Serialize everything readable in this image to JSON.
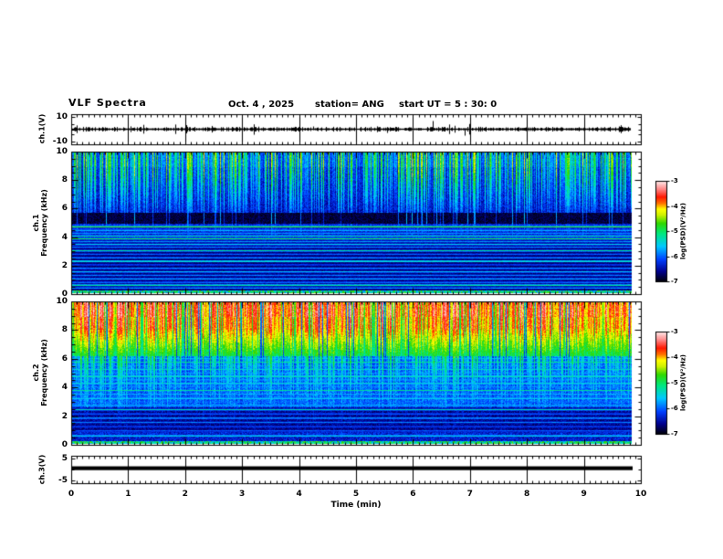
{
  "header": {
    "title": "VLF Spectra",
    "date": "Oct. 4 , 2025",
    "station": "station= ANG",
    "start_ut": "start UT =  5 : 30: 0"
  },
  "x_axis": {
    "label": "Time (min)",
    "tick_labels": [
      "0",
      "1",
      "2",
      "3",
      "4",
      "5",
      "6",
      "7",
      "8",
      "9",
      "10"
    ],
    "tick_values": [
      0,
      1,
      2,
      3,
      4,
      5,
      6,
      7,
      8,
      9,
      10
    ],
    "minor_step_min": 0.1,
    "range": [
      0,
      10
    ],
    "data_end_min": 9.82
  },
  "colorbar": {
    "label": "log(PSD)(V²/Hz)",
    "tick_labels": [
      "-3",
      "-4",
      "-5",
      "-6",
      "-7"
    ],
    "tick_values": [
      -3,
      -4,
      -5,
      -6,
      -7
    ],
    "value_range": [
      -7,
      -3
    ]
  },
  "colormap_stops": [
    [
      0.0,
      "#000008"
    ],
    [
      0.1,
      "#00008c"
    ],
    [
      0.22,
      "#0040ff"
    ],
    [
      0.35,
      "#00c8ff"
    ],
    [
      0.48,
      "#00e87a"
    ],
    [
      0.58,
      "#30d800"
    ],
    [
      0.66,
      "#ccf000"
    ],
    [
      0.72,
      "#ffff00"
    ],
    [
      0.78,
      "#ff7000"
    ],
    [
      0.84,
      "#ff1800"
    ],
    [
      0.92,
      "#ff8888"
    ],
    [
      1.0,
      "#ffecec"
    ]
  ],
  "chart_data": [
    {
      "id": "ch1-waveform",
      "type": "line",
      "ylabel": "ch.1(V)",
      "ylim": [
        -12.5,
        12.5
      ],
      "ytick_values": [
        10,
        -10
      ],
      "ytick_labels": [
        "10",
        "-10"
      ],
      "baseline_v": 0,
      "noise_v": 1.5,
      "seed": 5,
      "spikes": [
        {
          "t": 3.2,
          "v": -4.5
        },
        {
          "t": 4.25,
          "v": 3.0
        },
        {
          "t": 5.55,
          "v": -2.5
        },
        {
          "t": 6.35,
          "v": 7.5
        },
        {
          "t": 6.9,
          "v": -5.0
        }
      ]
    },
    {
      "id": "ch1-spectrogram",
      "type": "heatmap",
      "ylabel_lines": [
        "ch.1",
        "Frequency (kHz)"
      ],
      "ylim": [
        0,
        10
      ],
      "ytick_values": [
        0,
        2,
        4,
        6,
        8,
        10
      ],
      "ytick_labels": [
        "0",
        "2",
        "4",
        "6",
        "8",
        "10"
      ],
      "minor_step_kHz": 0.5,
      "seed": 42,
      "base_level": -6.95,
      "base_noise": 0.45,
      "streaks": {
        "density": 0.45,
        "min_freq": 5.6,
        "span": 4.2,
        "floor": 0.3,
        "gain": 2.1,
        "base": -6.75,
        "gap_dark": 0,
        "top_boost": 0.15,
        "leak_gain": 0.6,
        "leak_depth": 1.6,
        "leak_min_freq": 0.3
      },
      "dark_bands": [
        {
          "f0": 4.95,
          "f1": 5.75,
          "level": -7.0,
          "noise": 0.35,
          "leak": 1.2
        }
      ],
      "level_bands": [
        {
          "f0": 3.9,
          "f1": 4.95,
          "boost": 0.4
        },
        {
          "f0": 2.2,
          "f1": 3.2,
          "boost": -0.15
        },
        {
          "f0": 0.3,
          "f1": 1.4,
          "boost": 0.1
        }
      ],
      "transmitter_lines": [
        [
          4.75,
          2.1
        ],
        [
          4.5,
          1.2
        ],
        [
          4.3,
          1.0
        ],
        [
          4.1,
          1.5
        ],
        [
          3.9,
          1.9
        ],
        [
          3.7,
          1.0
        ],
        [
          3.5,
          1.3
        ],
        [
          3.3,
          0.9
        ],
        [
          3.05,
          1.6
        ],
        [
          2.8,
          0.8
        ],
        [
          2.55,
          1.0
        ],
        [
          2.3,
          1.6
        ],
        [
          2.05,
          0.7
        ],
        [
          1.8,
          1.0
        ],
        [
          1.55,
          1.2
        ],
        [
          1.3,
          0.9
        ],
        [
          1.05,
          1.1
        ],
        [
          0.8,
          0.9
        ],
        [
          0.6,
          1.7
        ],
        [
          0.4,
          1.0
        ]
      ],
      "bottom_row": {
        "f_max": 0.22,
        "level": -5.9,
        "noise": 1.4
      }
    },
    {
      "id": "ch2-spectrogram",
      "type": "heatmap",
      "ylabel_lines": [
        "ch.2",
        "Frequency (kHz)"
      ],
      "ylim": [
        0,
        10
      ],
      "ytick_values": [
        0,
        2,
        4,
        6,
        8,
        10
      ],
      "ytick_labels": [
        "0",
        "2",
        "4",
        "6",
        "8",
        "10"
      ],
      "minor_step_kHz": 0.5,
      "seed": 7,
      "base_level": -6.6,
      "base_noise": 0.5,
      "streaks": {
        "density": 0.78,
        "min_freq": 6.2,
        "span": 3.0,
        "floor": 0.3,
        "gain": 2.0,
        "base": -5.6,
        "gap_dark": 0.8,
        "top_boost": 0.2,
        "leak_gain": 1.5,
        "leak_depth": 2.2,
        "leak_min_freq": 0.5
      },
      "dark_bands": [],
      "level_bands": [
        {
          "f0": 0.9,
          "f1": 2.6,
          "boost": -0.3
        },
        {
          "f0": 2.6,
          "f1": 6.2,
          "boost": 0.25
        }
      ],
      "transmitter_lines": [
        [
          6.05,
          1.2
        ],
        [
          5.8,
          1.6
        ],
        [
          5.55,
          1.0
        ],
        [
          5.3,
          1.4
        ],
        [
          5.05,
          1.1
        ],
        [
          4.8,
          1.7
        ],
        [
          4.55,
          1.2
        ],
        [
          4.3,
          1.5
        ],
        [
          4.05,
          1.0
        ],
        [
          3.8,
          1.6
        ],
        [
          3.55,
          1.1
        ],
        [
          3.25,
          1.4
        ],
        [
          3.0,
          0.9
        ],
        [
          2.75,
          1.2
        ],
        [
          2.45,
          1.5
        ],
        [
          2.15,
          0.8
        ],
        [
          1.85,
          1.1
        ],
        [
          1.55,
          0.9
        ],
        [
          1.25,
          0.7
        ],
        [
          0.95,
          0.8
        ],
        [
          0.6,
          1.4
        ]
      ],
      "bottom_row": {
        "f_max": 0.22,
        "level": -5.8,
        "noise": 1.3
      }
    },
    {
      "id": "ch3-waveform",
      "type": "line",
      "ylabel": "ch.3(V)",
      "ylim": [
        -6.5,
        6.5
      ],
      "ytick_values": [
        5,
        -5
      ],
      "ytick_labels": [
        "5",
        "-5"
      ],
      "line_value_v": 0.6,
      "line_thickness_v": 1.8
    }
  ]
}
